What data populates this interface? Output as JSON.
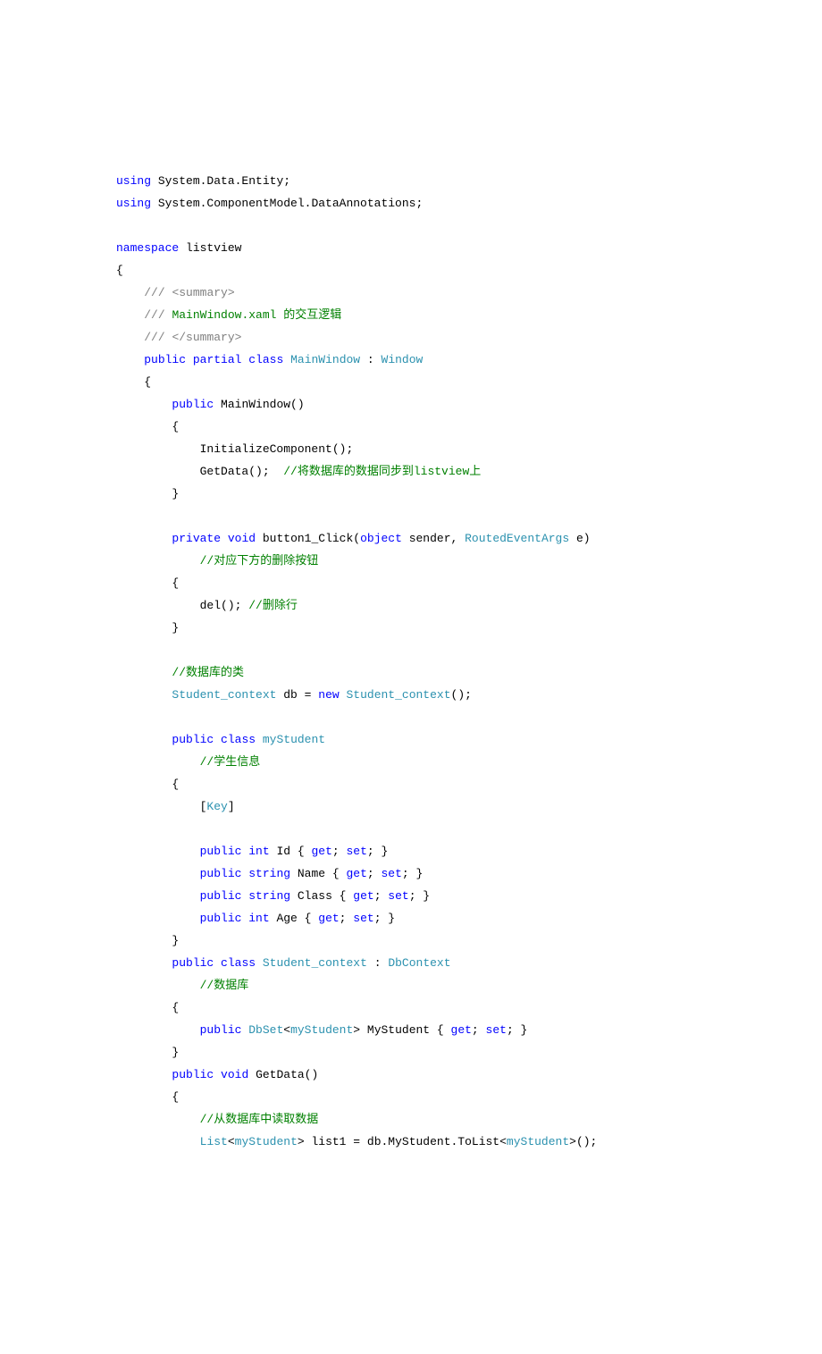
{
  "lines": [
    {
      "segments": [
        {
          "text": "using",
          "cls": "kw"
        },
        {
          "text": " System.Data.Entity;",
          "cls": "code"
        }
      ]
    },
    {
      "segments": [
        {
          "text": "using",
          "cls": "kw"
        },
        {
          "text": " System.ComponentModel.DataAnnotations;",
          "cls": "code"
        }
      ]
    },
    {
      "segments": [
        {
          "text": "",
          "cls": "code"
        }
      ]
    },
    {
      "segments": [
        {
          "text": "namespace",
          "cls": "kw"
        },
        {
          "text": " listview",
          "cls": "code"
        }
      ]
    },
    {
      "segments": [
        {
          "text": "{",
          "cls": "code"
        }
      ]
    },
    {
      "segments": [
        {
          "text": "    ",
          "cls": "code"
        },
        {
          "text": "///",
          "cls": "gray"
        },
        {
          "text": " ",
          "cls": "code"
        },
        {
          "text": "<summary>",
          "cls": "gray"
        }
      ]
    },
    {
      "segments": [
        {
          "text": "    ",
          "cls": "code"
        },
        {
          "text": "///",
          "cls": "gray"
        },
        {
          "text": " ",
          "cls": "code"
        },
        {
          "text": "MainWindow.xaml 的交互逻辑",
          "cls": "comment"
        }
      ]
    },
    {
      "segments": [
        {
          "text": "    ",
          "cls": "code"
        },
        {
          "text": "///",
          "cls": "gray"
        },
        {
          "text": " ",
          "cls": "code"
        },
        {
          "text": "</summary>",
          "cls": "gray"
        }
      ]
    },
    {
      "segments": [
        {
          "text": "    ",
          "cls": "code"
        },
        {
          "text": "public",
          "cls": "kw"
        },
        {
          "text": " ",
          "cls": "code"
        },
        {
          "text": "partial",
          "cls": "kw"
        },
        {
          "text": " ",
          "cls": "code"
        },
        {
          "text": "class",
          "cls": "kw"
        },
        {
          "text": " ",
          "cls": "code"
        },
        {
          "text": "MainWindow",
          "cls": "type"
        },
        {
          "text": " : ",
          "cls": "code"
        },
        {
          "text": "Window",
          "cls": "type"
        }
      ]
    },
    {
      "segments": [
        {
          "text": "    {",
          "cls": "code"
        }
      ]
    },
    {
      "segments": [
        {
          "text": "        ",
          "cls": "code"
        },
        {
          "text": "public",
          "cls": "kw"
        },
        {
          "text": " MainWindow()",
          "cls": "code"
        }
      ]
    },
    {
      "segments": [
        {
          "text": "        {",
          "cls": "code"
        }
      ]
    },
    {
      "segments": [
        {
          "text": "            InitializeComponent();",
          "cls": "code"
        }
      ]
    },
    {
      "segments": [
        {
          "text": "            GetData();  ",
          "cls": "code"
        },
        {
          "text": "//将数据库的数据同步到listview上",
          "cls": "comment"
        }
      ]
    },
    {
      "segments": [
        {
          "text": "        }",
          "cls": "code"
        }
      ]
    },
    {
      "segments": [
        {
          "text": "",
          "cls": "code"
        }
      ]
    },
    {
      "segments": [
        {
          "text": "        ",
          "cls": "code"
        },
        {
          "text": "private",
          "cls": "kw"
        },
        {
          "text": " ",
          "cls": "code"
        },
        {
          "text": "void",
          "cls": "kw"
        },
        {
          "text": " button1_Click(",
          "cls": "code"
        },
        {
          "text": "object",
          "cls": "kw"
        },
        {
          "text": " sender, ",
          "cls": "code"
        },
        {
          "text": "RoutedEventArgs",
          "cls": "type"
        },
        {
          "text": " e)",
          "cls": "code"
        }
      ]
    },
    {
      "segments": [
        {
          "text": "            ",
          "cls": "code"
        },
        {
          "text": "//对应下方的删除按钮",
          "cls": "comment"
        }
      ]
    },
    {
      "segments": [
        {
          "text": "        {",
          "cls": "code"
        }
      ]
    },
    {
      "segments": [
        {
          "text": "            del(); ",
          "cls": "code"
        },
        {
          "text": "//删除行",
          "cls": "comment"
        }
      ]
    },
    {
      "segments": [
        {
          "text": "        }",
          "cls": "code"
        }
      ]
    },
    {
      "segments": [
        {
          "text": "",
          "cls": "code"
        }
      ]
    },
    {
      "segments": [
        {
          "text": "        ",
          "cls": "code"
        },
        {
          "text": "//数据库的类",
          "cls": "comment"
        }
      ]
    },
    {
      "segments": [
        {
          "text": "        ",
          "cls": "code"
        },
        {
          "text": "Student_context",
          "cls": "type"
        },
        {
          "text": " db = ",
          "cls": "code"
        },
        {
          "text": "new",
          "cls": "kw"
        },
        {
          "text": " ",
          "cls": "code"
        },
        {
          "text": "Student_context",
          "cls": "type"
        },
        {
          "text": "();",
          "cls": "code"
        }
      ]
    },
    {
      "segments": [
        {
          "text": "",
          "cls": "code"
        }
      ]
    },
    {
      "segments": [
        {
          "text": "        ",
          "cls": "code"
        },
        {
          "text": "public",
          "cls": "kw"
        },
        {
          "text": " ",
          "cls": "code"
        },
        {
          "text": "class",
          "cls": "kw"
        },
        {
          "text": " ",
          "cls": "code"
        },
        {
          "text": "myStudent",
          "cls": "type"
        }
      ]
    },
    {
      "segments": [
        {
          "text": "            ",
          "cls": "code"
        },
        {
          "text": "//学生信息",
          "cls": "comment"
        }
      ]
    },
    {
      "segments": [
        {
          "text": "        {",
          "cls": "code"
        }
      ]
    },
    {
      "segments": [
        {
          "text": "            [",
          "cls": "code"
        },
        {
          "text": "Key",
          "cls": "type"
        },
        {
          "text": "]",
          "cls": "code"
        }
      ]
    },
    {
      "segments": [
        {
          "text": "",
          "cls": "code"
        }
      ]
    },
    {
      "segments": [
        {
          "text": "            ",
          "cls": "code"
        },
        {
          "text": "public",
          "cls": "kw"
        },
        {
          "text": " ",
          "cls": "code"
        },
        {
          "text": "int",
          "cls": "kw"
        },
        {
          "text": " Id { ",
          "cls": "code"
        },
        {
          "text": "get",
          "cls": "kw"
        },
        {
          "text": "; ",
          "cls": "code"
        },
        {
          "text": "set",
          "cls": "kw"
        },
        {
          "text": "; }",
          "cls": "code"
        }
      ]
    },
    {
      "segments": [
        {
          "text": "            ",
          "cls": "code"
        },
        {
          "text": "public",
          "cls": "kw"
        },
        {
          "text": " ",
          "cls": "code"
        },
        {
          "text": "string",
          "cls": "kw"
        },
        {
          "text": " Name { ",
          "cls": "code"
        },
        {
          "text": "get",
          "cls": "kw"
        },
        {
          "text": "; ",
          "cls": "code"
        },
        {
          "text": "set",
          "cls": "kw"
        },
        {
          "text": "; }",
          "cls": "code"
        }
      ]
    },
    {
      "segments": [
        {
          "text": "            ",
          "cls": "code"
        },
        {
          "text": "public",
          "cls": "kw"
        },
        {
          "text": " ",
          "cls": "code"
        },
        {
          "text": "string",
          "cls": "kw"
        },
        {
          "text": " Class { ",
          "cls": "code"
        },
        {
          "text": "get",
          "cls": "kw"
        },
        {
          "text": "; ",
          "cls": "code"
        },
        {
          "text": "set",
          "cls": "kw"
        },
        {
          "text": "; }",
          "cls": "code"
        }
      ]
    },
    {
      "segments": [
        {
          "text": "            ",
          "cls": "code"
        },
        {
          "text": "public",
          "cls": "kw"
        },
        {
          "text": " ",
          "cls": "code"
        },
        {
          "text": "int",
          "cls": "kw"
        },
        {
          "text": " Age { ",
          "cls": "code"
        },
        {
          "text": "get",
          "cls": "kw"
        },
        {
          "text": "; ",
          "cls": "code"
        },
        {
          "text": "set",
          "cls": "kw"
        },
        {
          "text": "; }",
          "cls": "code"
        }
      ]
    },
    {
      "segments": [
        {
          "text": "        }",
          "cls": "code"
        }
      ]
    },
    {
      "segments": [
        {
          "text": "        ",
          "cls": "code"
        },
        {
          "text": "public",
          "cls": "kw"
        },
        {
          "text": " ",
          "cls": "code"
        },
        {
          "text": "class",
          "cls": "kw"
        },
        {
          "text": " ",
          "cls": "code"
        },
        {
          "text": "Student_context",
          "cls": "type"
        },
        {
          "text": " : ",
          "cls": "code"
        },
        {
          "text": "DbContext",
          "cls": "type"
        }
      ]
    },
    {
      "segments": [
        {
          "text": "            ",
          "cls": "code"
        },
        {
          "text": "//数据库",
          "cls": "comment"
        }
      ]
    },
    {
      "segments": [
        {
          "text": "        {",
          "cls": "code"
        }
      ]
    },
    {
      "segments": [
        {
          "text": "            ",
          "cls": "code"
        },
        {
          "text": "public",
          "cls": "kw"
        },
        {
          "text": " ",
          "cls": "code"
        },
        {
          "text": "DbSet",
          "cls": "type"
        },
        {
          "text": "<",
          "cls": "code"
        },
        {
          "text": "myStudent",
          "cls": "type"
        },
        {
          "text": "> MyStudent { ",
          "cls": "code"
        },
        {
          "text": "get",
          "cls": "kw"
        },
        {
          "text": "; ",
          "cls": "code"
        },
        {
          "text": "set",
          "cls": "kw"
        },
        {
          "text": "; }",
          "cls": "code"
        }
      ]
    },
    {
      "segments": [
        {
          "text": "        }",
          "cls": "code"
        }
      ]
    },
    {
      "segments": [
        {
          "text": "        ",
          "cls": "code"
        },
        {
          "text": "public",
          "cls": "kw"
        },
        {
          "text": " ",
          "cls": "code"
        },
        {
          "text": "void",
          "cls": "kw"
        },
        {
          "text": " GetData()",
          "cls": "code"
        }
      ]
    },
    {
      "segments": [
        {
          "text": "        {",
          "cls": "code"
        }
      ]
    },
    {
      "segments": [
        {
          "text": "            ",
          "cls": "code"
        },
        {
          "text": "//从数据库中读取数据",
          "cls": "comment"
        }
      ]
    },
    {
      "segments": [
        {
          "text": "            ",
          "cls": "code"
        },
        {
          "text": "List",
          "cls": "type"
        },
        {
          "text": "<",
          "cls": "code"
        },
        {
          "text": "myStudent",
          "cls": "type"
        },
        {
          "text": "> list1 = db.MyStudent.ToList<",
          "cls": "code"
        },
        {
          "text": "myStudent",
          "cls": "type"
        },
        {
          "text": ">();",
          "cls": "code"
        }
      ]
    }
  ]
}
